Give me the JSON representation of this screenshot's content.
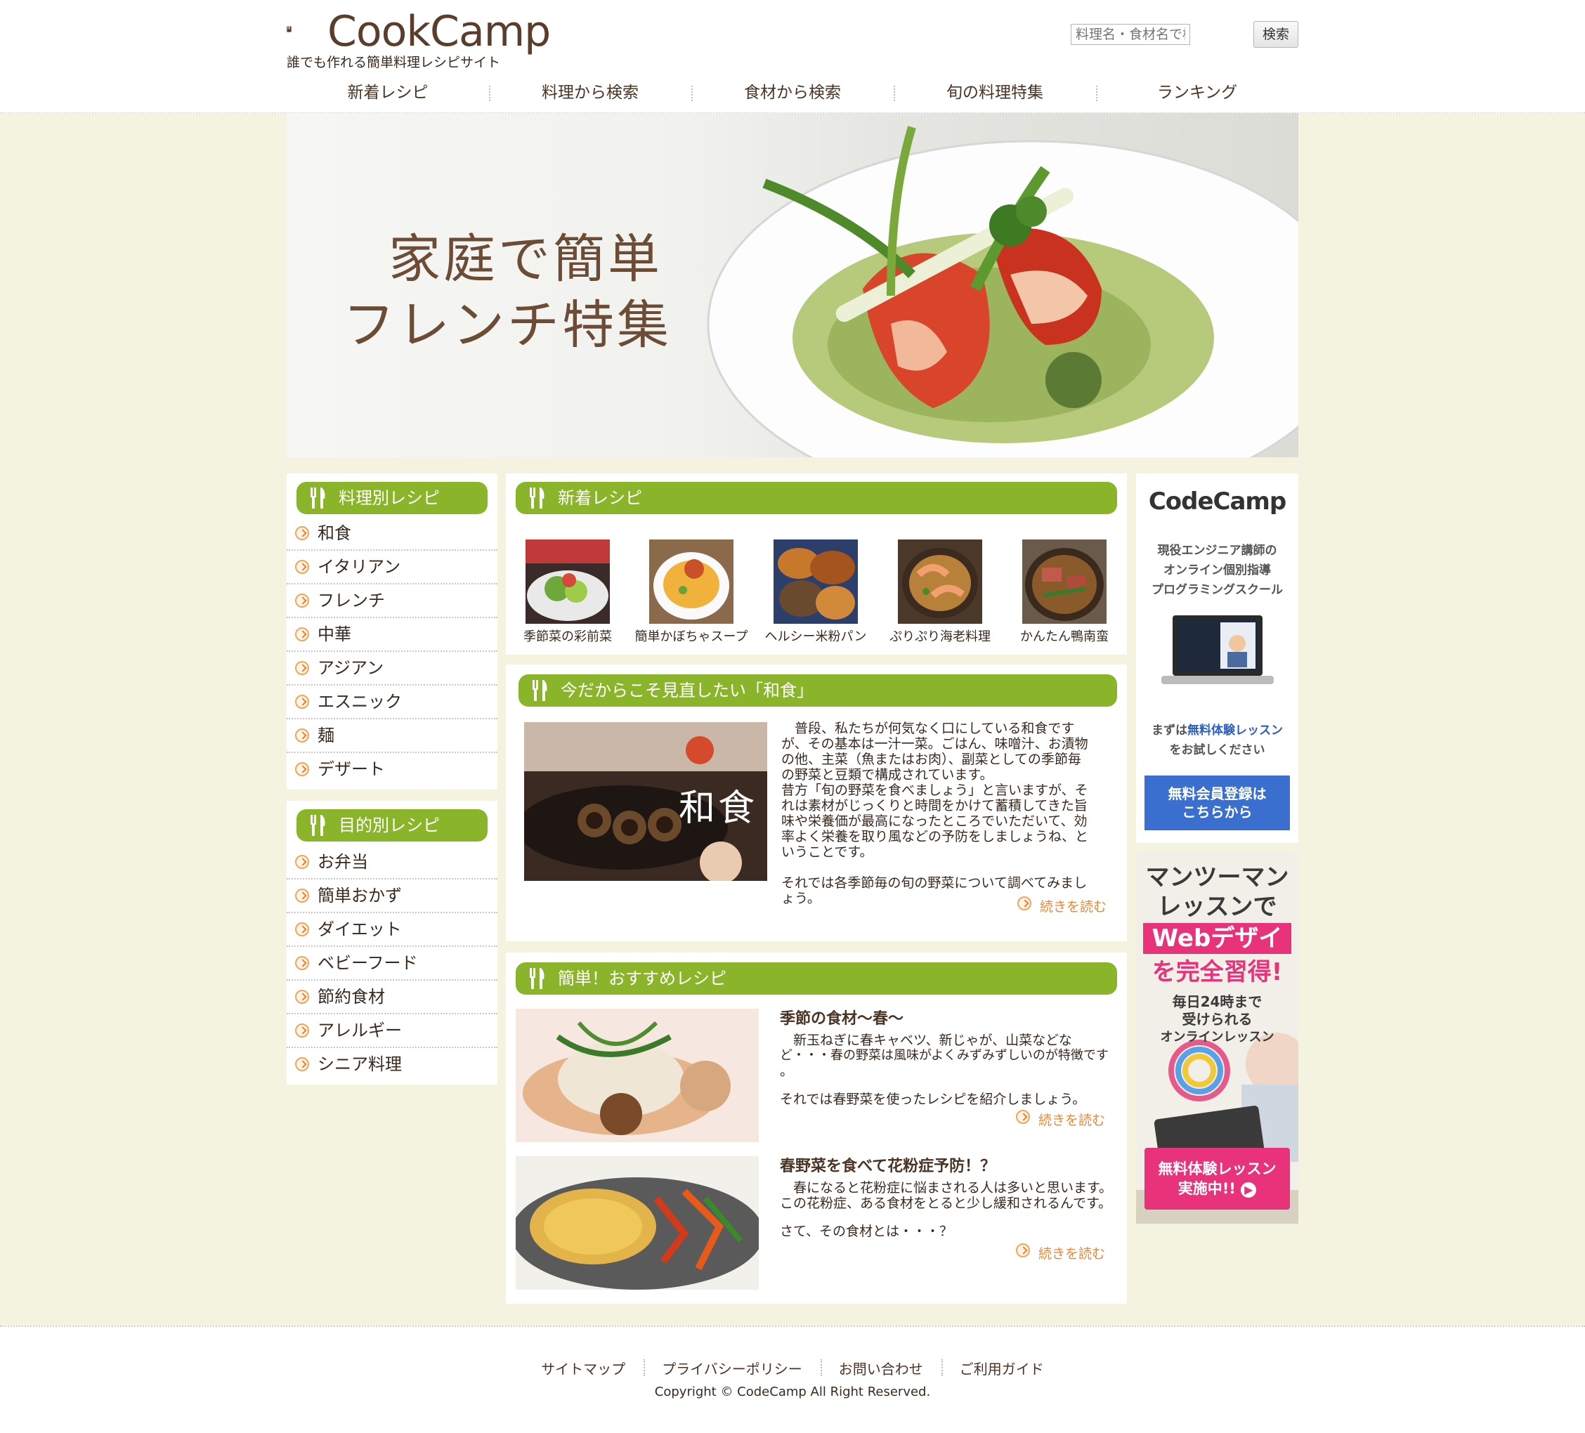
{
  "site": {
    "logo_text": "CookCamp",
    "tagline": "誰でも作れる簡単料理レシピサイト"
  },
  "search": {
    "placeholder": "料理名・食材名で検索",
    "button_label": "検索"
  },
  "nav": [
    "新着レシピ",
    "料理から検索",
    "食材から検索",
    "旬の料理特集",
    "ランキング"
  ],
  "hero": {
    "line1": "家庭で簡単",
    "line2": "フレンチ特集"
  },
  "sidebar": {
    "cuisine_heading": "料理別レシピ",
    "cuisine_items": [
      "和食",
      "イタリアン",
      "フレンチ",
      "中華",
      "アジアン",
      "エスニック",
      "麺",
      "デザート"
    ],
    "purpose_heading": "目的別レシピ",
    "purpose_items": [
      "お弁当",
      "簡単おかず",
      "ダイエット",
      "ベビーフード",
      "節約食材",
      "アレルギー",
      "シニア料理"
    ]
  },
  "new_recipes": {
    "heading": "新着レシピ",
    "items": [
      "季節菜の彩前菜",
      "簡単かぼちゃスープ",
      "ヘルシー米粉パン",
      "ぷりぷり海老料理",
      "かんたん鴨南蛮"
    ]
  },
  "washoku": {
    "heading": "今だからこそ見直したい「和食」",
    "image_caption": "和食",
    "paragraph_lines": [
      "　普段、私たちが何気なく口にしている和食です",
      "が、その基本は一汁一菜。ごはん、味噌汁、お漬物",
      "の他、主菜（魚またはお肉）、副菜としての季節毎",
      "の野菜と豆類で構成されています。",
      "昔方「旬の野菜を食べましょう」と言いますが、そ",
      "れは素材がじっくりと時間をかけて蓄積してきた旨",
      "味や栄養価が最高になったところでいただいて、効",
      "率よく栄養を取り風などの予防をしましょうね、と",
      "いうことです。"
    ],
    "paragraph2_lines": [
      "それでは各季節毎の旬の野菜について調べてみまし",
      "ょう。"
    ],
    "more": "続きを読む"
  },
  "recommended": {
    "heading": "簡単！おすすめレシピ",
    "articles": [
      {
        "title": "季節の食材〜春〜",
        "lines": [
          "　新玉ねぎに春キャベツ、新じゃが、山菜などな",
          "ど・・・春の野菜は風味がよくみずみずしいのが特徴です",
          "。"
        ],
        "lines2": [
          "それでは春野菜を使ったレシピを紹介しましょう。"
        ],
        "more": "続きを読む"
      },
      {
        "title": "春野菜を食べて花粉症予防！？",
        "lines": [
          "　春になると花粉症に悩まされる人は多いと思います。",
          "この花粉症、ある食材をとると少し緩和されるんです。"
        ],
        "lines2": [
          "さて、その食材とは・・・？"
        ],
        "more": "続きを読む"
      }
    ]
  },
  "ad1": {
    "brand": "CodeCamp",
    "line1": "現役エンジニア講師の",
    "line2": "オンライン個別指導",
    "line3": "プログラミングスクール",
    "cta_prefix": "まずは",
    "cta_highlight": "無料体験レッスン",
    "cta_suffix": "をお試しください",
    "button_line1": "無料会員登録は",
    "button_line2": "こちらから"
  },
  "ad2": {
    "line1": "マンツーマン",
    "line2": "レッスンで",
    "line3": "Webデザイン",
    "line4": "を完全習得!",
    "line5": "毎日24時まで",
    "line6": "受けられる",
    "line7": "オンラインレッスン",
    "button_line1": "無料体験レッスン",
    "button_line2": "実施中!!"
  },
  "footer": {
    "links": [
      "サイトマップ",
      "プライバシーポリシー",
      "お問い合わせ",
      "ご利用ガイド"
    ],
    "copyright": "Copyright © CodeCamp All Right Reserved."
  },
  "colors": {
    "accent_green": "#8ab52a",
    "page_bg": "#f3f3e0",
    "brown_text": "#4a3424",
    "orange_link": "#e88a3c",
    "ad_blue_button": "#3a6fd0",
    "ad_pink_button": "#e8337a"
  }
}
